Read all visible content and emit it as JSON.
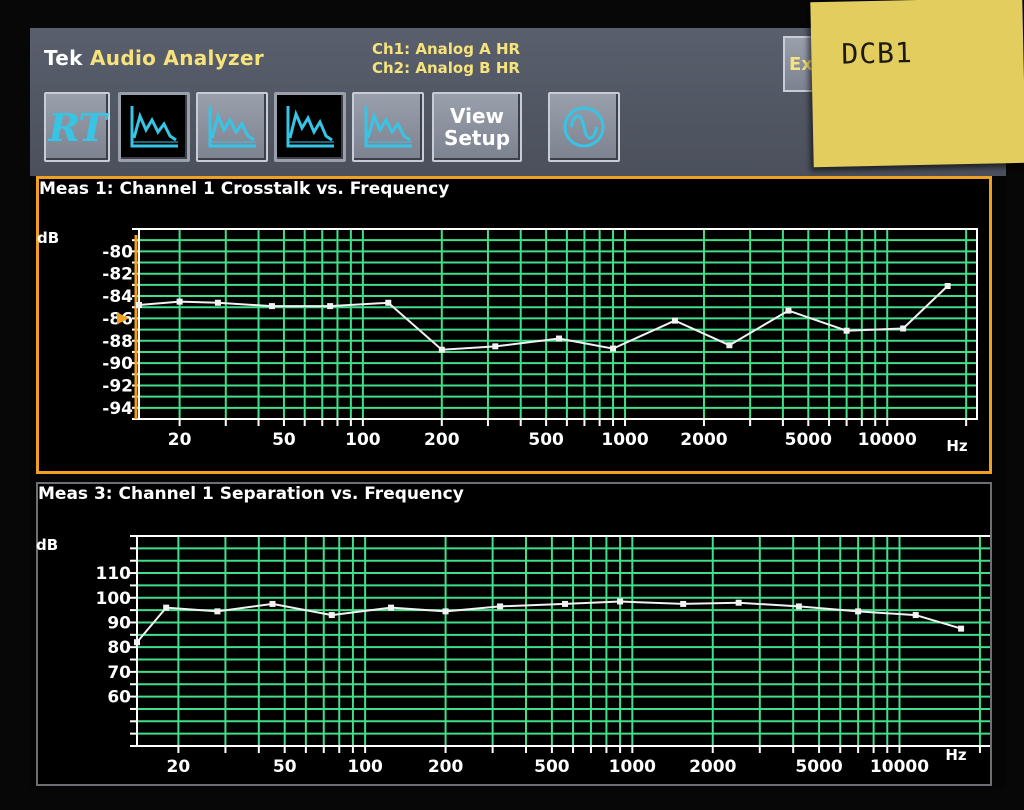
{
  "app": {
    "brand": "Tek",
    "title": "Audio Analyzer"
  },
  "channels": {
    "ch1": "Ch1: Analog A HR",
    "ch2": "Ch2: Analog B HR"
  },
  "toolbar": {
    "rt_label": "RT",
    "view_setup_line1": "View",
    "view_setup_line2": "Setup",
    "exp_label": "Exp"
  },
  "sticky_note": "DCB1",
  "colors": {
    "grid": "#3fe089",
    "trace": "#f2f2f2",
    "accent_cyan": "#38c4e4",
    "active_border": "#f0a020",
    "label_yellow": "#f6e37b"
  },
  "chart_data": [
    {
      "type": "line",
      "title": "Meas 1: Channel 1 Crosstalk vs. Frequency",
      "ylabel": "dB",
      "xlabel": "Hz",
      "xscale": "log",
      "xlim": [
        14,
        22000
      ],
      "ylim": [
        -95,
        -78
      ],
      "x_ticks": [
        "20",
        "50",
        "100",
        "200",
        "500",
        "1000",
        "2000",
        "5000",
        "10000"
      ],
      "y_ticks": [
        "-80",
        "-82",
        "-84",
        "-86",
        "-88",
        "-90",
        "-92",
        "-94"
      ],
      "grid": true,
      "series": [
        {
          "x": [
            14,
            20,
            28,
            45,
            75,
            125,
            200,
            320,
            560,
            900,
            1550,
            2500,
            4200,
            7000,
            11500,
            17000
          ],
          "y": [
            -84.8,
            -84.5,
            -84.6,
            -84.9,
            -84.9,
            -84.6,
            -88.8,
            -88.5,
            -87.8,
            -88.7,
            -86.2,
            -88.4,
            -85.3,
            -87.1,
            -86.9,
            -83.1
          ]
        }
      ]
    },
    {
      "type": "line",
      "title": "Meas 3: Channel 1 Separation vs. Frequency",
      "ylabel": "dB",
      "xlabel": "Hz",
      "xscale": "log",
      "xlim": [
        14,
        22000
      ],
      "ylim": [
        40,
        125
      ],
      "x_ticks": [
        "20",
        "50",
        "100",
        "200",
        "500",
        "1000",
        "2000",
        "5000",
        "10000"
      ],
      "y_ticks": [
        "60",
        "70",
        "80",
        "90",
        "100",
        "110"
      ],
      "grid": true,
      "series": [
        {
          "x": [
            14,
            18,
            28,
            45,
            75,
            125,
            200,
            320,
            560,
            900,
            1550,
            2500,
            4200,
            7000,
            11500,
            17000
          ],
          "y": [
            82,
            96,
            94.5,
            97.5,
            93,
            96,
            94.5,
            96.5,
            97.5,
            98.5,
            97.5,
            98,
            96.5,
            94.5,
            93,
            87.5
          ]
        }
      ]
    }
  ]
}
